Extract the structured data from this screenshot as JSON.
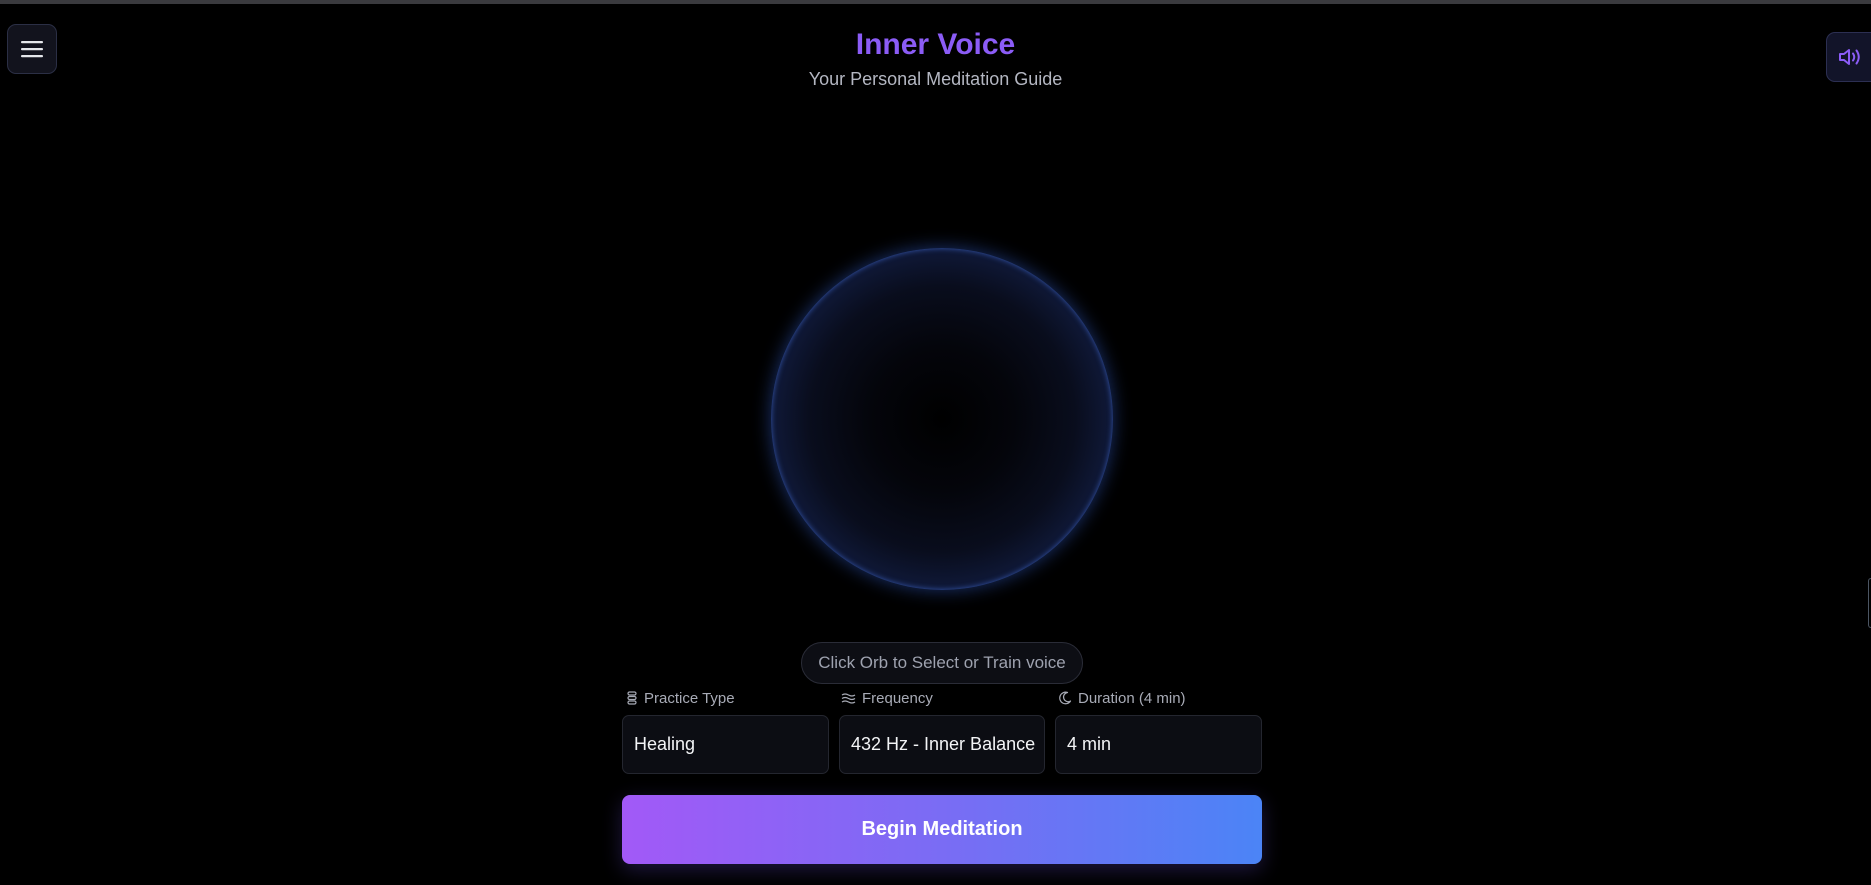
{
  "header": {
    "title": "Inner Voice",
    "subtitle": "Your Personal Meditation Guide"
  },
  "toolbar": {
    "menu_icon": "hamburger-menu-icon",
    "sound_icon": "speaker-volume-icon"
  },
  "orb": {
    "hint": "Click Orb to Select or Train voice"
  },
  "settings": {
    "practice_type": {
      "label": "Practice Type",
      "icon": "lotus-icon",
      "value": "Healing"
    },
    "frequency": {
      "label": "Frequency",
      "icon": "waves-icon",
      "value": "432 Hz - Inner Balance"
    },
    "duration": {
      "label": "Duration (4 min)",
      "icon": "moon-icon",
      "value": "4 min"
    }
  },
  "actions": {
    "begin_label": "Begin Meditation"
  },
  "colors": {
    "accent_purple": "#8b5cf6",
    "gradient_start": "#a259f7",
    "gradient_end": "#4b84f6",
    "orb_rim": "#3d6ef2",
    "background": "#000000"
  }
}
